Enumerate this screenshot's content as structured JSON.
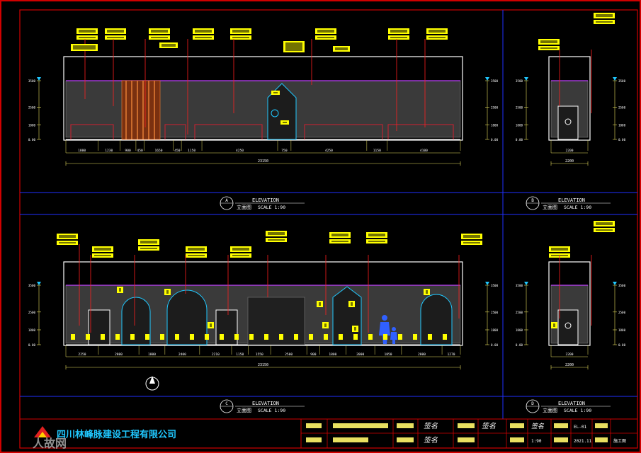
{
  "views": [
    {
      "id": "A",
      "title": "ELEVATION",
      "subtitle": "立面图",
      "scale": "SCALE 1:90",
      "dims": [
        "1800",
        "1230",
        "900",
        "450",
        "1650",
        "450",
        "1150",
        "4250",
        "750",
        "4250",
        "1150",
        "4100"
      ],
      "total": "23150"
    },
    {
      "id": "B",
      "title": "ELEVATION",
      "subtitle": "立面图",
      "scale": "SCALE 1:90",
      "dims": [
        "2200"
      ],
      "total": "2200"
    },
    {
      "id": "C",
      "title": "ELEVATION",
      "subtitle": "立面图",
      "scale": "SCALE 1:90",
      "dims": [
        "2250",
        "2800",
        "1800",
        "2400",
        "2210",
        "1150",
        "1550",
        "2500",
        "900",
        "1800",
        "2000",
        "1850",
        "2800",
        "1270"
      ],
      "total": "23150"
    },
    {
      "id": "D",
      "title": "ELEVATION",
      "subtitle": "立面图",
      "scale": "SCALE 1:90",
      "dims": [
        "2200"
      ],
      "total": "2200"
    }
  ],
  "elev_marks": [
    "3500",
    "2500",
    "1800",
    "0.00"
  ],
  "title_block": {
    "company": "四川林峰脉建设工程有限公司",
    "watermark": "人故网",
    "sheet_no": "EL-01",
    "date": "2021.11",
    "scale": "1:90",
    "stage": "施工图"
  },
  "colors": {
    "frame": "#d00000",
    "wall": "#3a3a3a",
    "dim": "#e8e060",
    "tag": "#ffff00",
    "leader": "#ff2020",
    "text": "#ffffff",
    "cyan": "#20c8ff",
    "figure": "#3060ff"
  }
}
